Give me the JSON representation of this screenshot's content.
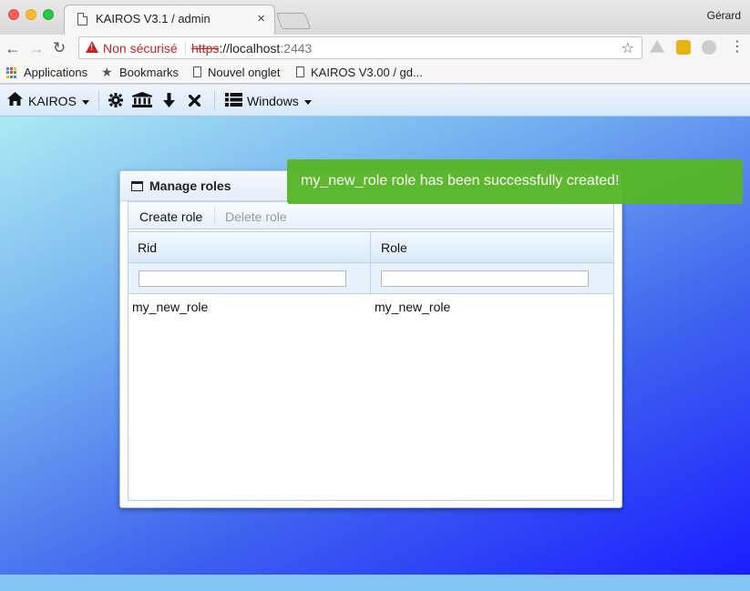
{
  "browser": {
    "tab_title": "KAIROS V3.1 / admin",
    "tab_close": "×",
    "profile_name": "Gérard",
    "security_label": "Non sécurisé",
    "url_scheme": "https",
    "url_sep": "://",
    "url_host": "localhost",
    "url_port": ":2443",
    "bookmarks": {
      "apps": "Applications",
      "bookmarks": "Bookmarks",
      "new_tab": "Nouvel onglet",
      "kairos": "KAIROS V3.00 / gd..."
    }
  },
  "app_toolbar": {
    "home_label": "KAIROS",
    "windows_label": "Windows"
  },
  "window": {
    "title": "Manage roles",
    "create_button": "Create role",
    "delete_button": "Delete role",
    "columns": [
      "Rid",
      "Role"
    ],
    "rows": [
      {
        "rid": "my_new_role",
        "role": "my_new_role"
      }
    ]
  },
  "notification": {
    "message": "my_new_role role has been successfully created!",
    "color": "#56b527"
  },
  "colors": {
    "insecure": "#c5221f",
    "desktop_top": "#a9ebf3",
    "desktop_bottom": "#1a1eff"
  }
}
